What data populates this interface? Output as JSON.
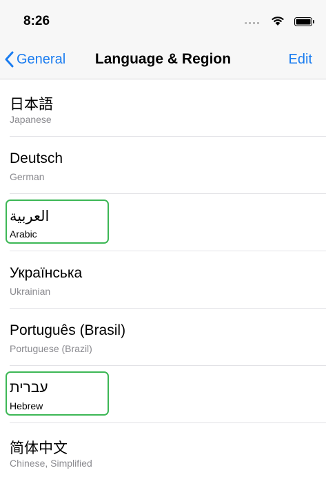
{
  "status_bar": {
    "time": "8:26"
  },
  "nav": {
    "back_label": "General",
    "title": "Language & Region",
    "edit_label": "Edit"
  },
  "languages": [
    {
      "native": "日本語",
      "english": "Japanese"
    },
    {
      "native": "Deutsch",
      "english": "German"
    },
    {
      "native": "العربية",
      "english": "Arabic"
    },
    {
      "native": "Українська",
      "english": "Ukrainian"
    },
    {
      "native": "Português (Brasil)",
      "english": "Portuguese (Brazil)"
    },
    {
      "native": "עברית",
      "english": "Hebrew"
    },
    {
      "native": "简体中文",
      "english": "Chinese, Simplified"
    }
  ],
  "colors": {
    "accent": "#1a7cf0",
    "highlight": "#3cb755"
  },
  "icons": [
    "chevron-left-icon",
    "wifi-icon",
    "battery-icon",
    "signal-dots-icon"
  ]
}
